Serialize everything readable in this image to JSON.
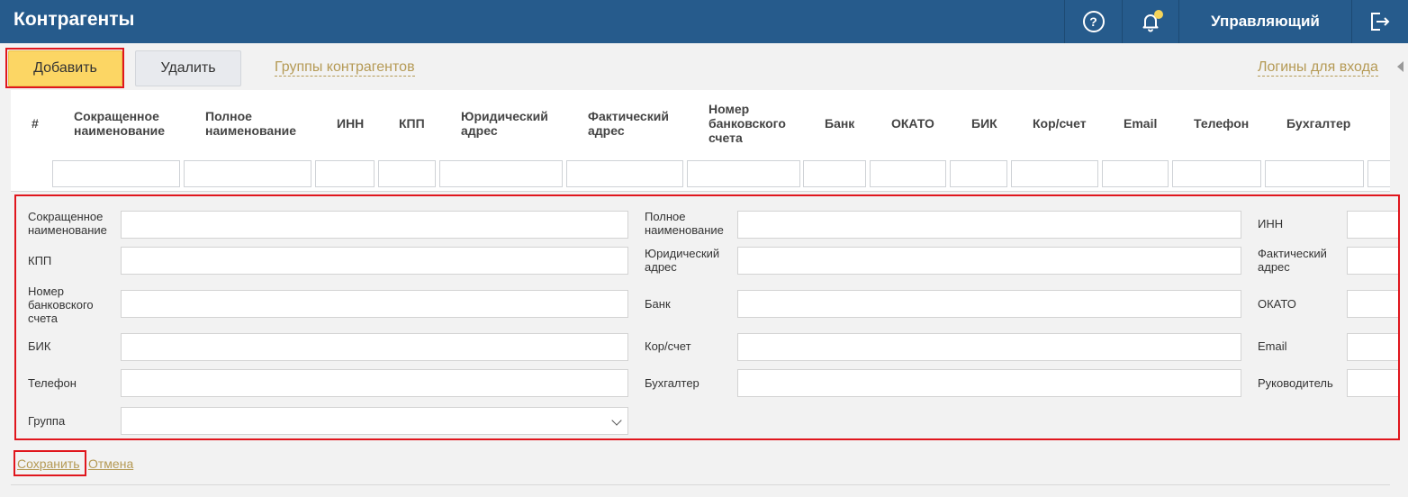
{
  "header": {
    "title": "Контрагенты",
    "help_icon": "help-icon",
    "bell_icon": "bell-icon",
    "user": "Управляющий",
    "logout_icon": "logout-icon"
  },
  "toolbar": {
    "add_label": "Добавить",
    "delete_label": "Удалить",
    "groups_link": "Группы контрагентов",
    "logins_link": "Логины для входа"
  },
  "grid": {
    "columns": [
      "#",
      "Сокращенное наименование",
      "Полное наименование",
      "ИНН",
      "КПП",
      "Юридический адрес",
      "Фактический адрес",
      "Номер банковского счета",
      "Банк",
      "ОКАТО",
      "БИК",
      "Кор/счет",
      "Email",
      "Телефон",
      "Бухгалтер"
    ]
  },
  "form": {
    "short_name": "Сокращенное наименование",
    "full_name": "Полное наименование",
    "inn": "ИНН",
    "kpp": "КПП",
    "legal_address": "Юридический адрес",
    "actual_address": "Фактический адрес",
    "bank_account": "Номер банковского счета",
    "bank": "Банк",
    "okato": "ОКАТО",
    "bik": "БИК",
    "corr_account": "Кор/счет",
    "email": "Email",
    "phone": "Телефон",
    "accountant": "Бухгалтер",
    "director": "Руководитель",
    "group": "Группа"
  },
  "actions": {
    "save": "Сохранить",
    "cancel": "Отмена"
  },
  "colors": {
    "header_bg": "#265b8c",
    "accent_yellow": "#fcd664",
    "link_gold": "#b59a55",
    "highlight_red": "#e0161d"
  }
}
